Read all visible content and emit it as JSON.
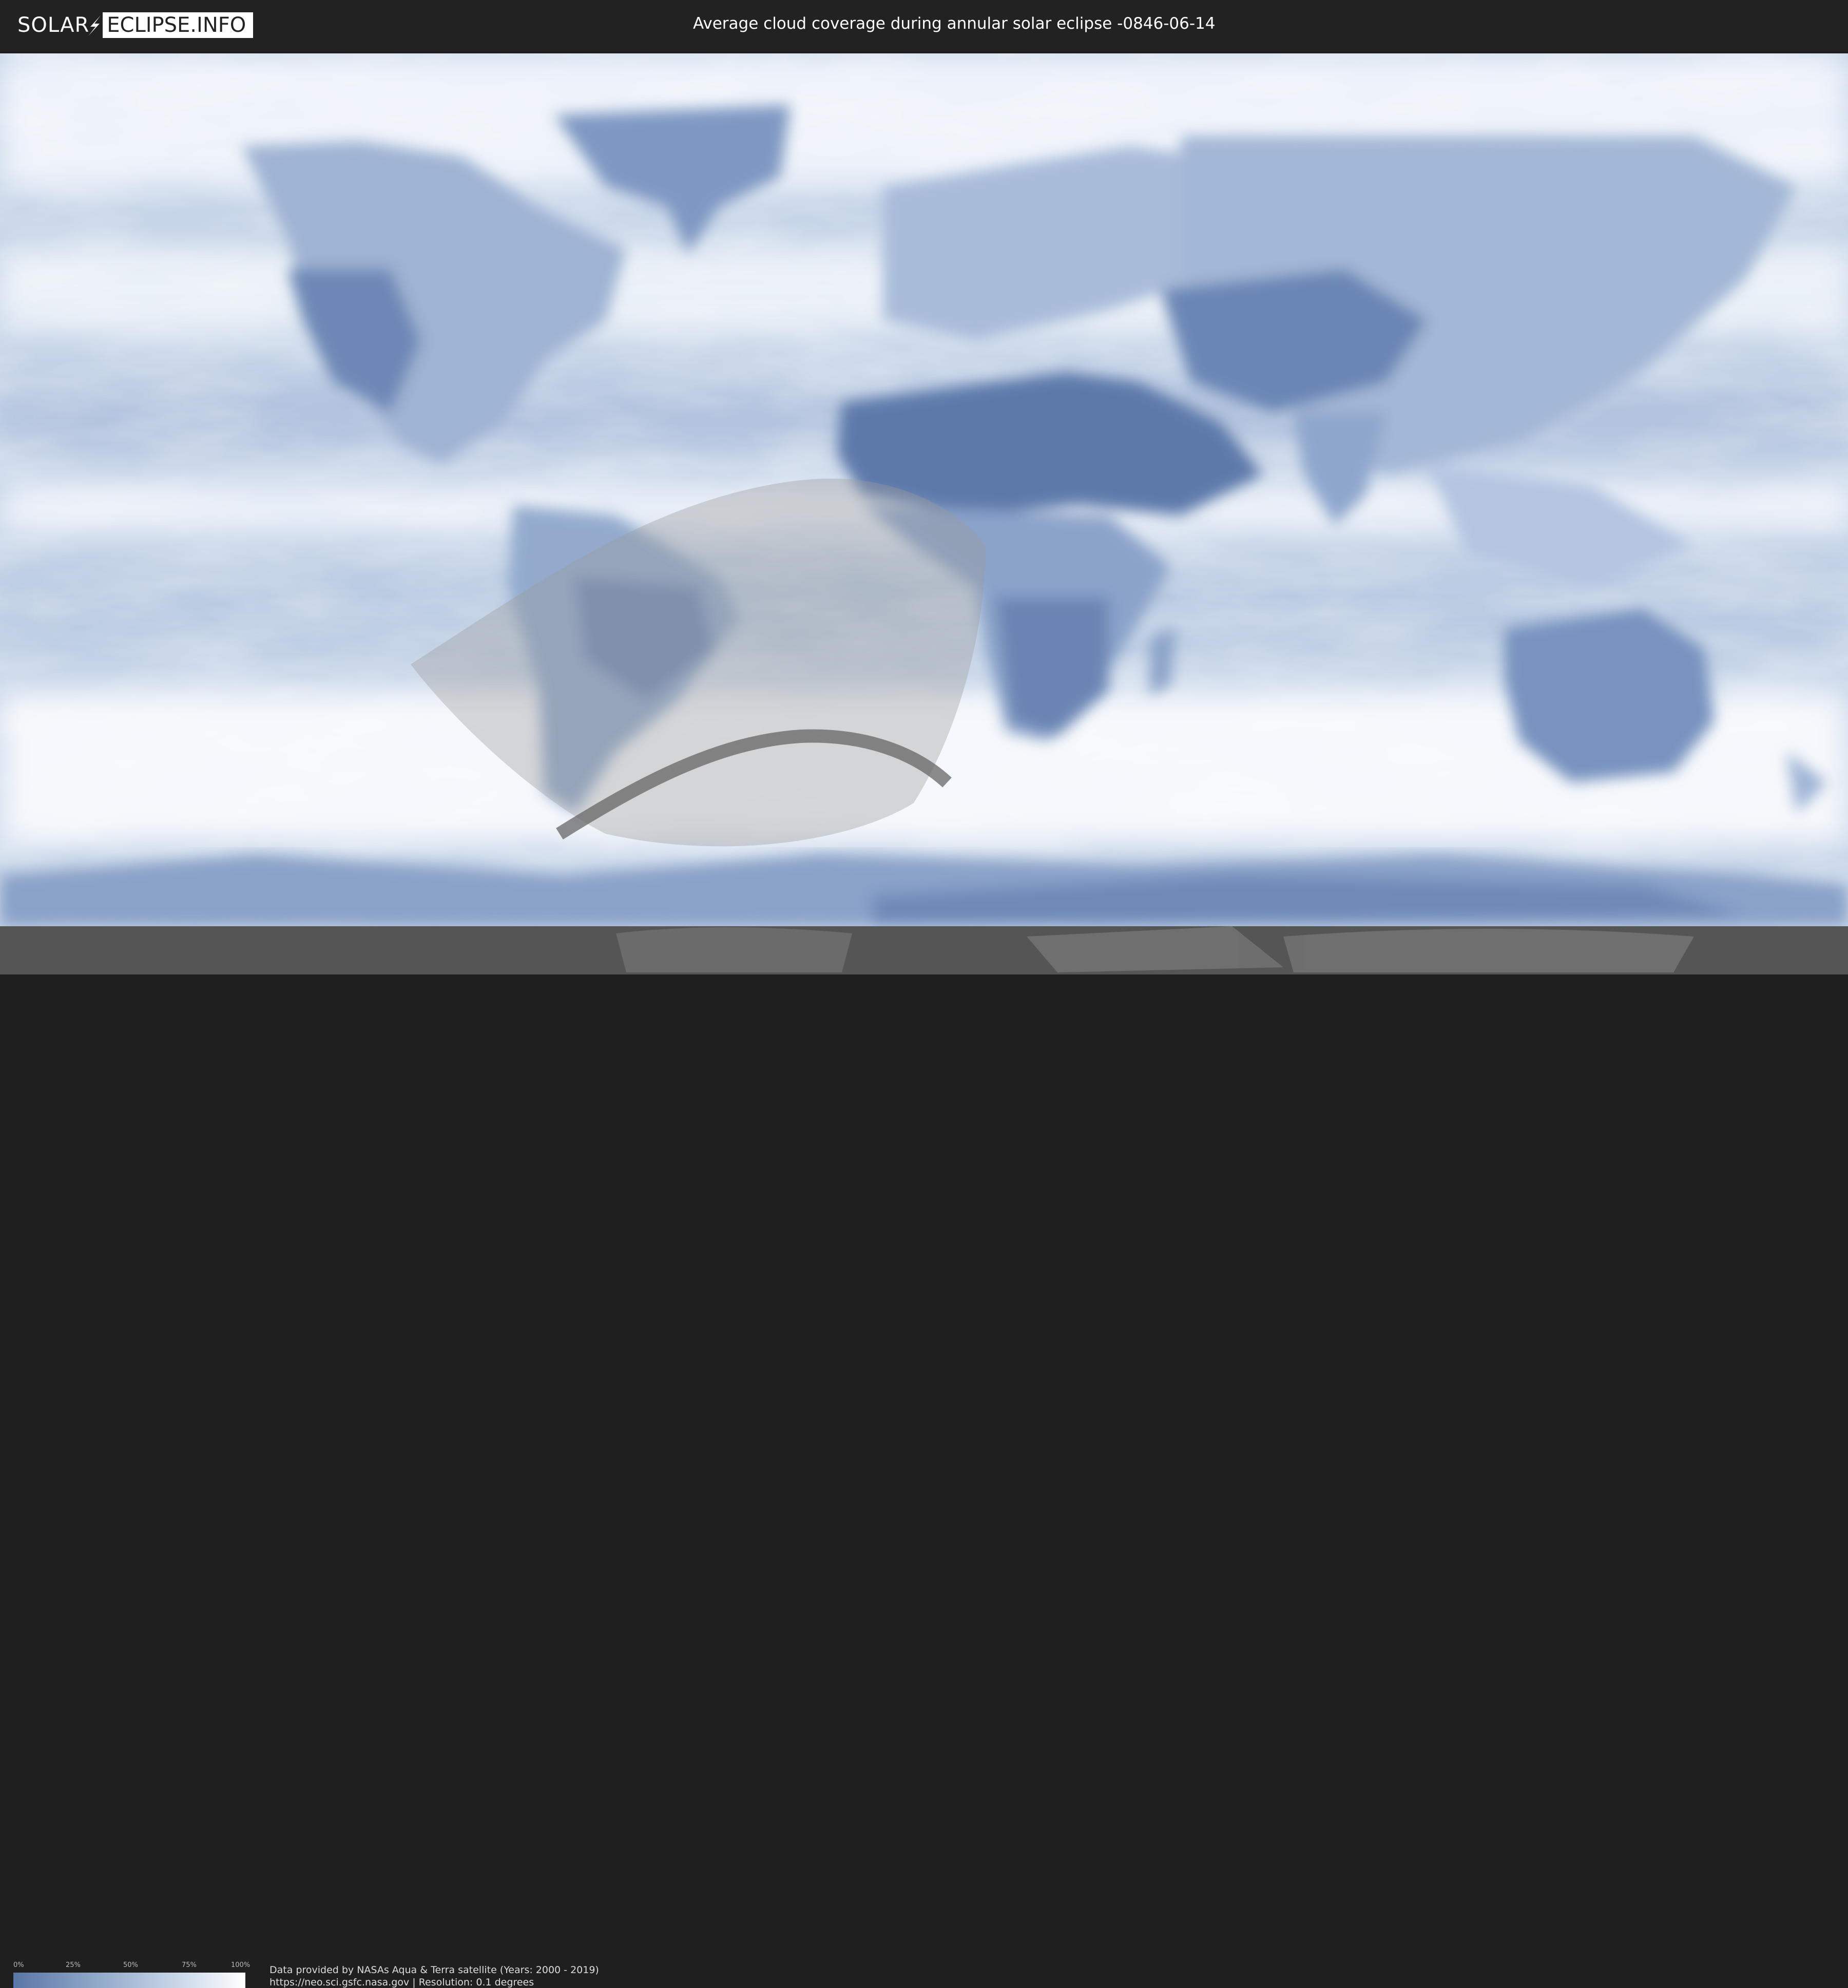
{
  "brand": {
    "logo_left": "SOLAR",
    "logo_right": "ECLIPSE.INFO"
  },
  "title": "Average cloud coverage during annular solar eclipse -0846-06-14",
  "legend": {
    "ticks": [
      "0%",
      "25%",
      "50%",
      "75%",
      "100%"
    ],
    "color_low": "#5a76a6",
    "color_high": "#ffffff"
  },
  "credits": {
    "line1": "Data provided by NASAs Aqua & Terra satellite (Years: 2000 - 2019)",
    "line2": "https://neo.sci.gsfc.nasa.gov | Resolution: 0.1 degrees"
  },
  "map": {
    "projection": "equirectangular",
    "colors": {
      "cloud": "#ffffff",
      "clear_sky": "#5a76a6",
      "eclipse_overlay": "#9a9a9a",
      "annular_path": "#666666",
      "polar_band": "#555555"
    }
  }
}
